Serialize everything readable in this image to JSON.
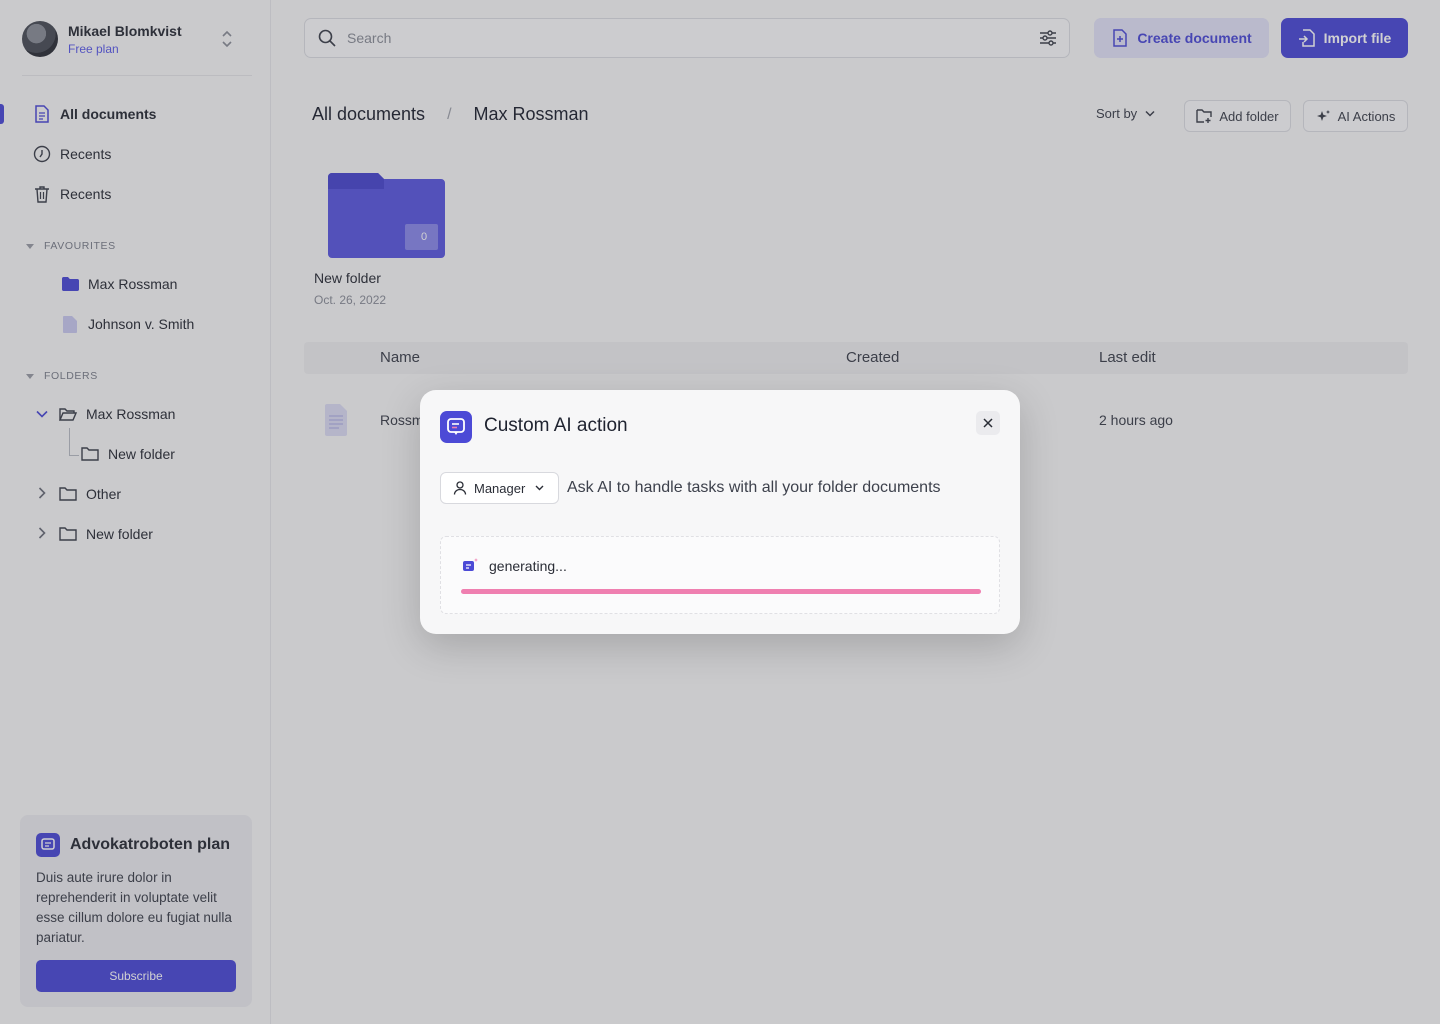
{
  "user": {
    "name": "Mikael Blomkvist",
    "plan": "Free plan"
  },
  "nav": [
    {
      "label": "All documents",
      "icon": "document-icon"
    },
    {
      "label": "Recents",
      "icon": "clock-icon"
    },
    {
      "label": "Recents",
      "icon": "trash-icon"
    }
  ],
  "favourites": {
    "label": "FAVOURITES",
    "items": [
      {
        "label": "Max Rossman",
        "icon": "folder-filled-icon"
      },
      {
        "label": "Johnson v. Smith",
        "icon": "file-icon"
      }
    ]
  },
  "folders": {
    "label": "FOLDERS",
    "items": [
      {
        "label": "Max Rossman",
        "expanded": true
      },
      {
        "label": "New folder",
        "child": true
      },
      {
        "label": "Other",
        "expanded": false
      },
      {
        "label": "New folder",
        "expanded": false
      }
    ]
  },
  "plan_card": {
    "title": "Advokatroboten plan",
    "description": "Duis aute irure dolor in reprehenderit in voluptate velit esse cillum dolore eu fugiat nulla pariatur.",
    "button": "Subscribe"
  },
  "search": {
    "placeholder": "Search"
  },
  "header": {
    "create_label": "Create document",
    "import_label": "Import file"
  },
  "breadcrumb": {
    "root": "All documents",
    "separator": "/",
    "current": "Max Rossman"
  },
  "toolbar": {
    "sort_label": "Sort by",
    "add_folder_label": "Add folder",
    "ai_actions_label": "AI Actions"
  },
  "folder_card": {
    "name": "New folder",
    "date": "Oct. 26, 2022",
    "count": "0"
  },
  "table": {
    "columns": [
      "Name",
      "Created",
      "Last edit"
    ],
    "rows": [
      {
        "name": "Rossm",
        "created": "",
        "last_edit": "2 hours ago"
      }
    ]
  },
  "modal": {
    "title": "Custom AI action",
    "role": "Manager",
    "prompt": "Ask AI to handle tasks with all your folder documents",
    "status": "generating...",
    "progress": 1.0
  },
  "colors": {
    "accent": "#4c4ad6",
    "progress": "#ef7fb0",
    "overlay": "#3c3c42"
  }
}
